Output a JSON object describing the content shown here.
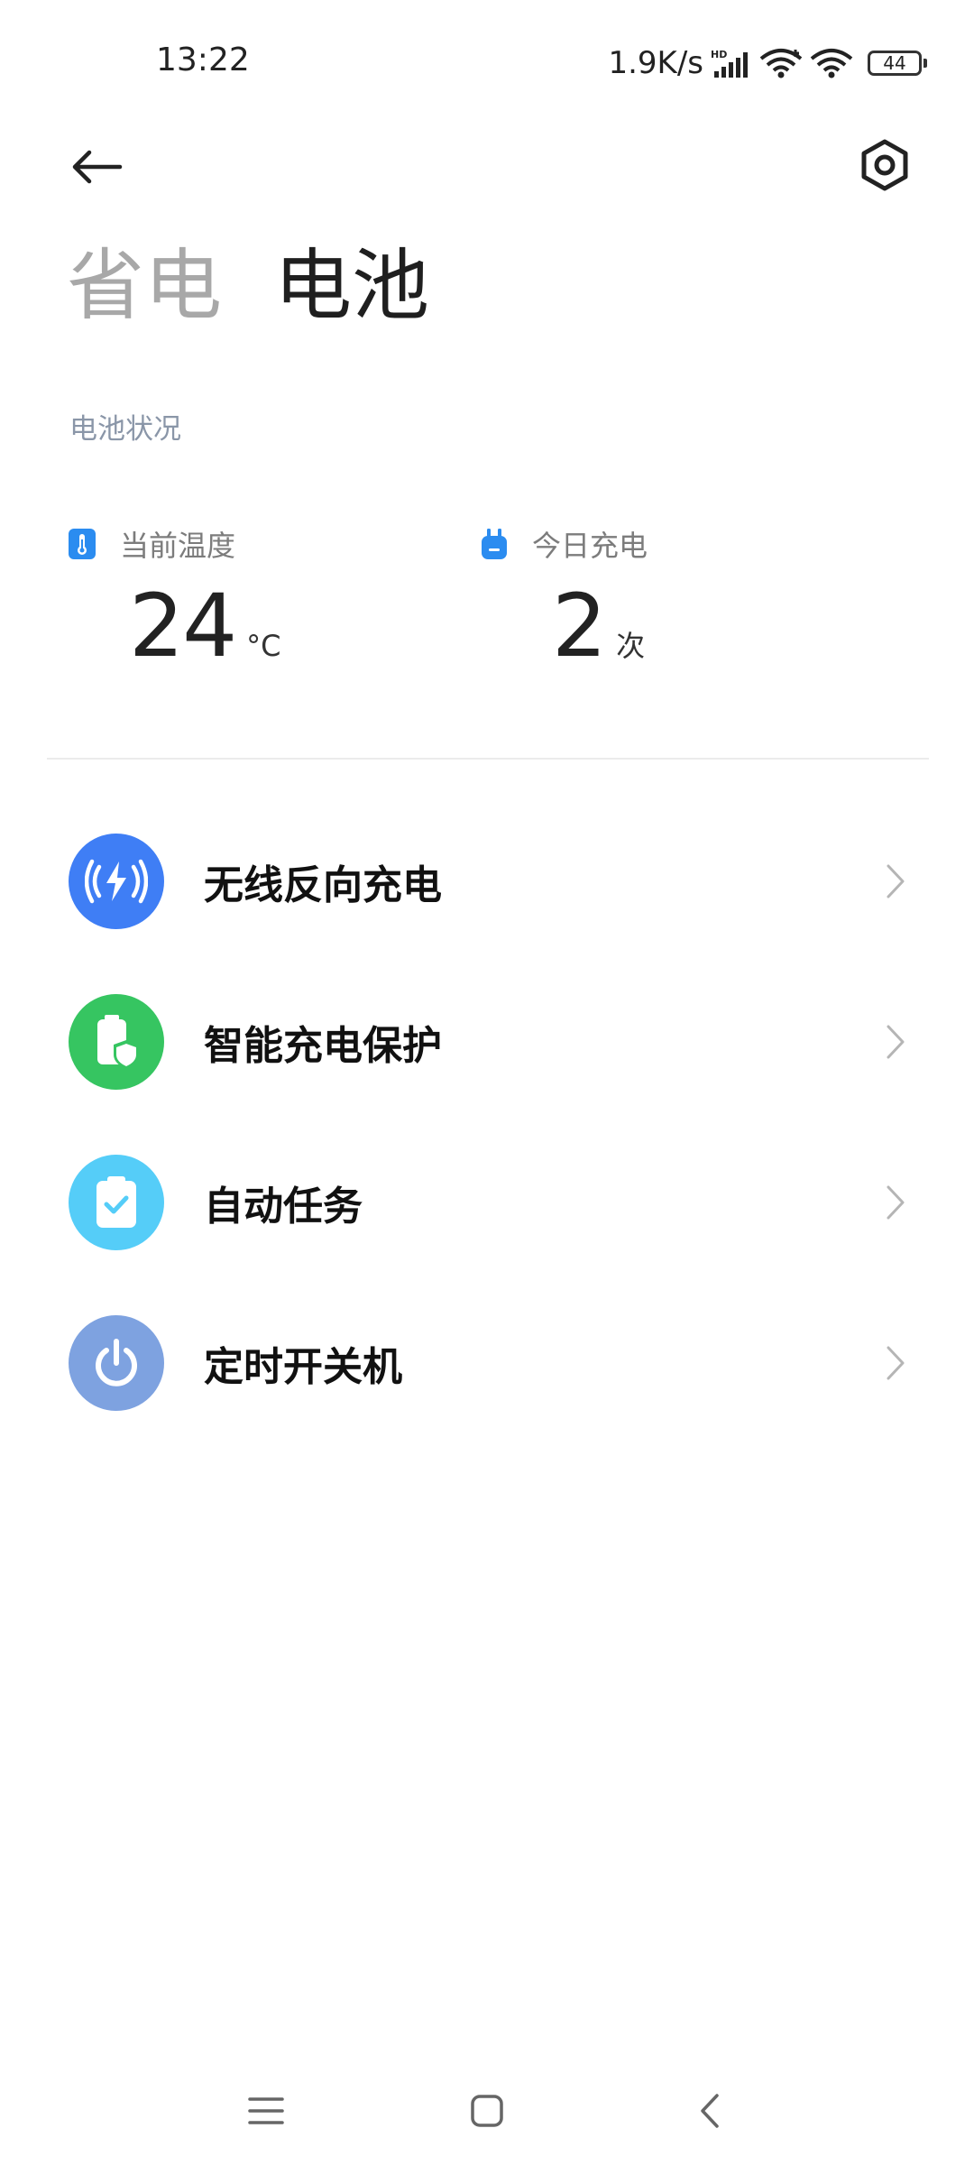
{
  "status_bar": {
    "time": "13:22",
    "net_speed": "1.9K/s",
    "signal_label": "HD",
    "battery": "44"
  },
  "header": {
    "back_icon": "arrow-left-icon",
    "settings_icon": "hexagon-gear-icon",
    "tabs": [
      {
        "label": "省电",
        "active": false
      },
      {
        "label": "电池",
        "active": true
      }
    ]
  },
  "battery_status": {
    "section_label": "电池状况",
    "temperature": {
      "label": "当前温度",
      "value": "24",
      "unit": "°C",
      "icon": "thermometer-icon",
      "icon_color": "#2b8cf0"
    },
    "charges_today": {
      "label": "今日充电",
      "value": "2",
      "unit": "次",
      "icon": "plug-icon",
      "icon_color": "#2b8cf0"
    }
  },
  "menu": {
    "items": [
      {
        "label": "无线反向充电",
        "icon": "wireless-charging-icon",
        "color": "#3f7ef5"
      },
      {
        "label": "智能充电保护",
        "icon": "battery-shield-icon",
        "color": "#36c561"
      },
      {
        "label": "自动任务",
        "icon": "clipboard-check-icon",
        "color": "#55cdf8"
      },
      {
        "label": "定时开关机",
        "icon": "power-icon",
        "color": "#7ea2e0"
      }
    ]
  },
  "nav": {
    "menu_icon": "menu-icon",
    "home_icon": "home-square-icon",
    "back_icon": "back-chevron-icon"
  }
}
